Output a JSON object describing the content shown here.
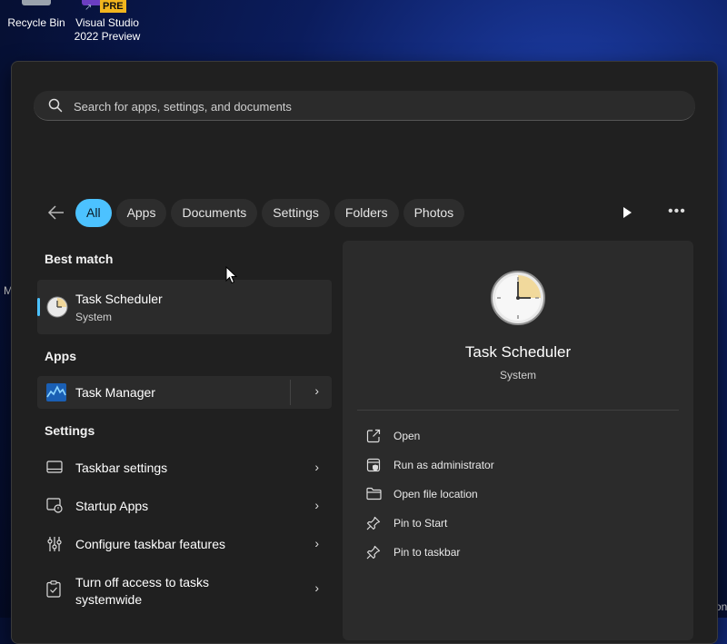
{
  "desktop": {
    "icons": [
      {
        "label": "Recycle Bin"
      },
      {
        "label": "Visual Studio 2022 Preview",
        "badge": "PRE"
      }
    ],
    "edge_text_left": "M",
    "edge_text_right": "on"
  },
  "search": {
    "placeholder": "Search for apps, settings, and documents",
    "value": ""
  },
  "filters": {
    "chips": [
      "All",
      "Apps",
      "Documents",
      "Settings",
      "Folders",
      "Photos"
    ],
    "active": "All"
  },
  "results": {
    "best_match_title": "Best match",
    "best_match": {
      "name": "Task Scheduler",
      "type": "System"
    },
    "apps_title": "Apps",
    "apps": [
      {
        "name": "Task Manager"
      }
    ],
    "settings_title": "Settings",
    "settings": [
      {
        "name": "Taskbar settings",
        "icon": "taskbar-icon"
      },
      {
        "name": "Startup Apps",
        "icon": "startup-apps-icon"
      },
      {
        "name": "Configure taskbar features",
        "icon": "taskbar-features-icon"
      },
      {
        "name": "Turn off access to tasks systemwide",
        "line1": "Turn off access to tasks",
        "line2": "systemwide",
        "icon": "clipboard-check-icon"
      }
    ]
  },
  "detail": {
    "name": "Task Scheduler",
    "type": "System",
    "actions": [
      {
        "label": "Open",
        "icon": "open-external-icon"
      },
      {
        "label": "Run as administrator",
        "icon": "shield-admin-icon"
      },
      {
        "label": "Open file location",
        "icon": "folder-icon"
      },
      {
        "label": "Pin to Start",
        "icon": "pin-icon"
      },
      {
        "label": "Pin to taskbar",
        "icon": "pin-icon"
      }
    ]
  },
  "colors": {
    "accent": "#4cc2ff",
    "panel": "#202020",
    "card": "#2b2b2b"
  }
}
